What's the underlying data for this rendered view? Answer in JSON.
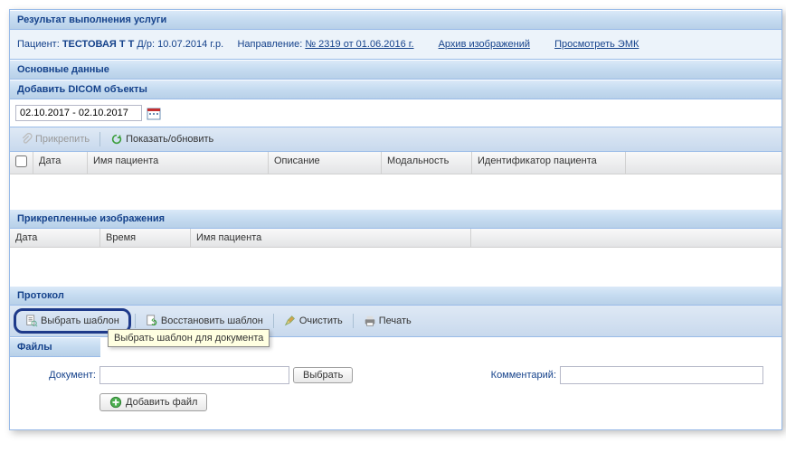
{
  "header": {
    "title": "Результат выполнения услуги"
  },
  "patient": {
    "label": "Пациент:",
    "name": "ТЕСТОВАЯ Т Т",
    "dob_label": "Д/р:",
    "dob": "10.07.2014",
    "dob_suffix": "г.р.",
    "direction_label": "Направление:",
    "direction_link": "№ 2319  от 01.06.2016  г.",
    "archive_link": "Архив изображений",
    "emk_link": "Просмотреть ЭМК"
  },
  "sections": {
    "main_data": "Основные данные",
    "dicom": "Добавить DICOM объекты",
    "attached": "Прикрепленные изображения",
    "protocol": "Протокол",
    "files": "Файлы"
  },
  "date_range": "02.10.2017 - 02.10.2017",
  "dicom_toolbar": {
    "attach": "Прикрепить",
    "refresh": "Показать/обновить"
  },
  "dicom_grid": {
    "cols": [
      "Дата",
      "Имя пациента",
      "Описание",
      "Модальность",
      "Идентификатор пациента",
      ""
    ]
  },
  "attached_grid": {
    "cols": [
      "Дата",
      "Время",
      "Имя пациента"
    ]
  },
  "protocol_toolbar": {
    "select_template": "Выбрать шаблон",
    "restore_template": "Восстановить шаблон",
    "clear": "Очистить",
    "print": "Печать"
  },
  "tooltip": "Выбрать шаблон для документа",
  "files_area": {
    "document_label": "Документ:",
    "select_btn": "Выбрать",
    "comment_label": "Комментарий:",
    "add_file_btn": "Добавить файл"
  }
}
